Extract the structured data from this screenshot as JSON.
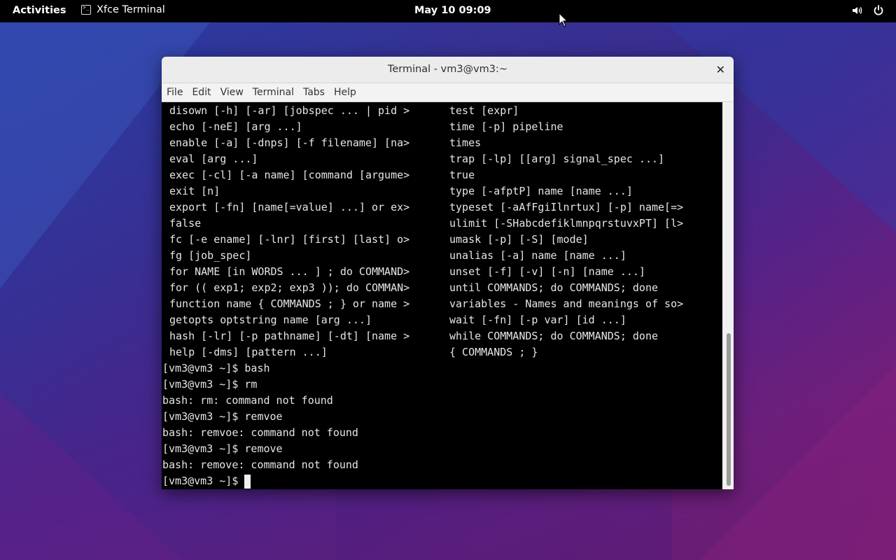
{
  "topbar": {
    "activities": "Activities",
    "app_name": "Xfce Terminal",
    "clock": "May 10  09:09"
  },
  "icons": {
    "app": "terminal-icon",
    "volume": "volume-icon",
    "power": "power-icon",
    "cursor": "mouse-pointer-icon",
    "close": "close-icon"
  },
  "window": {
    "title": "Terminal - vm3@vm3:~",
    "close_glyph": "✕",
    "menu": [
      "File",
      "Edit",
      "View",
      "Terminal",
      "Tabs",
      "Help"
    ]
  },
  "terminal": {
    "left_column": [
      "disown [-h] [-ar] [jobspec ... | pid >",
      "echo [-neE] [arg ...]",
      "enable [-a] [-dnps] [-f filename] [na>",
      "eval [arg ...]",
      "exec [-cl] [-a name] [command [argume>",
      "exit [n]",
      "export [-fn] [name[=value] ...] or ex>",
      "false",
      "fc [-e ename] [-lnr] [first] [last] o>",
      "fg [job_spec]",
      "for NAME [in WORDS ... ] ; do COMMAND>",
      "for (( exp1; exp2; exp3 )); do COMMAN>",
      "function name { COMMANDS ; } or name >",
      "getopts optstring name [arg ...]",
      "hash [-lr] [-p pathname] [-dt] [name >",
      "help [-dms] [pattern ...]"
    ],
    "right_column": [
      "test [expr]",
      "time [-p] pipeline",
      "times",
      "trap [-lp] [[arg] signal_spec ...]",
      "true",
      "type [-afptP] name [name ...]",
      "typeset [-aAfFgiIlnrtux] [-p] name[=>",
      "ulimit [-SHabcdefiklmnpqrstuvxPT] [l>",
      "umask [-p] [-S] [mode]",
      "unalias [-a] name [name ...]",
      "unset [-f] [-v] [-n] [name ...]",
      "until COMMANDS; do COMMANDS; done",
      "variables - Names and meanings of so>",
      "wait [-fn] [-p var] [id ...]",
      "while COMMANDS; do COMMANDS; done",
      "{ COMMANDS ; }"
    ],
    "session": [
      "[vm3@vm3 ~]$ bash",
      "[vm3@vm3 ~]$ rm",
      "bash: rm: command not found",
      "[vm3@vm3 ~]$ remvoe",
      "bash: remvoe: command not found",
      "[vm3@vm3 ~]$ remove",
      "bash: remove: command not found"
    ],
    "prompt": "[vm3@vm3 ~]$"
  }
}
